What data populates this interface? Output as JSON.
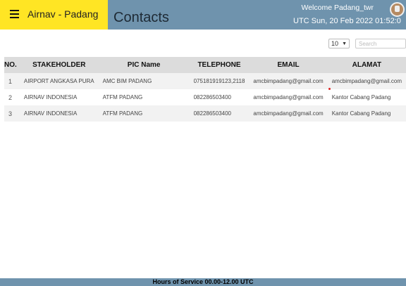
{
  "brand": {
    "title": "Airnav - Padang"
  },
  "header": {
    "page_title": "Contacts",
    "welcome": "Welcome Padang_twr",
    "utc": "UTC Sun, 20 Feb 2022 01:52:0"
  },
  "controls": {
    "page_size": "10",
    "search_placeholder": "Search"
  },
  "table": {
    "columns": [
      "NO.",
      "STAKEHOLDER",
      "PIC Name",
      "TELEPHONE",
      "EMAIL",
      "ALAMAT"
    ],
    "rows": [
      [
        "1",
        "AIRPORT ANGKASA PURA",
        "AMC BIM PADANG",
        "075181919123,2118",
        "amcbimpadang@gmail.com",
        "amcbimpadang@gmail.com"
      ],
      [
        "2",
        "AIRNAV INDONESIA",
        "ATFM PADANG",
        "082286503400",
        "amcbimpadang@gmail.com",
        "Kantor Cabang Padang"
      ],
      [
        "3",
        "AIRNAV INDONESIA",
        "ATFM PADANG",
        "082286503400",
        "amcbimpadang@gmail.com",
        "Kantor Cabang Padang"
      ]
    ]
  },
  "footer": {
    "text": "Hours of Service 00.00-12.00 UTC"
  },
  "colors": {
    "brand": "#ffe524",
    "header": "#6f93ad",
    "table_header": "#dcdcdc"
  },
  "icons": {
    "menu": "hamburger-menu-icon",
    "avatar": "user-avatar-icon",
    "search": "search-icon",
    "dropdown": "chevron-down-icon"
  }
}
